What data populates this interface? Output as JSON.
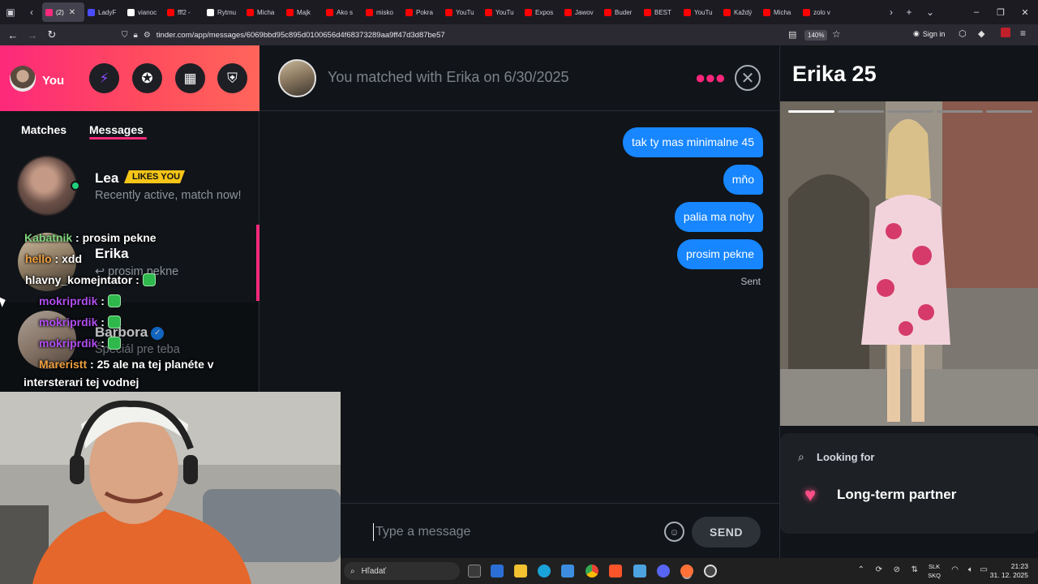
{
  "browser": {
    "tabs": [
      {
        "label": "(2)",
        "color": "#fd297b",
        "active": true
      },
      {
        "label": "LadyF",
        "color": "#4a4cff"
      },
      {
        "label": "vianoc",
        "color": "#ffffff"
      },
      {
        "label": "fff2 - ",
        "color": "#ff0000"
      },
      {
        "label": "Rytmu",
        "color": "#ffffff"
      },
      {
        "label": "Micha",
        "color": "#ff0000"
      },
      {
        "label": "Majk",
        "color": "#ff0000"
      },
      {
        "label": "Ako s",
        "color": "#ff0000"
      },
      {
        "label": "misko",
        "color": "#ff0000"
      },
      {
        "label": "Pokra",
        "color": "#ff0000"
      },
      {
        "label": "YouTu",
        "color": "#ff0000"
      },
      {
        "label": "YouTu",
        "color": "#ff0000"
      },
      {
        "label": "Expos",
        "color": "#ff0000"
      },
      {
        "label": "Jawov",
        "color": "#ff0000"
      },
      {
        "label": "Buder",
        "color": "#ff0000"
      },
      {
        "label": "BEST",
        "color": "#ff0000"
      },
      {
        "label": "YouTu",
        "color": "#ff0000"
      },
      {
        "label": "Každý",
        "color": "#ff0000"
      },
      {
        "label": "Micha",
        "color": "#ff0000"
      },
      {
        "label": "zolo v",
        "color": "#ff0000"
      }
    ],
    "url": "tinder.com/app/messages/6069bbd95c895d0100656d4f68373289aa9ff47d3d87be57",
    "zoom": "140%",
    "sign_in": "Sign in"
  },
  "left": {
    "you_label": "You",
    "tabs": {
      "matches": "Matches",
      "messages": "Messages"
    },
    "conversations": [
      {
        "name": "Lea",
        "badge": "LIKES YOU",
        "sub": "Recently active, match now!"
      },
      {
        "name": "Erika",
        "sub": "↩ prosim pekne"
      },
      {
        "name": "Barbora",
        "sub": "Špeciál pre teba"
      }
    ]
  },
  "chat_overlay": [
    {
      "user": "Kabatnik",
      "user_color": "#7fd37f",
      "text": " : prosim pekne"
    },
    {
      "user": "hello",
      "user_color": "#f0a040",
      "text": " : xdd"
    },
    {
      "user": "hlavny_komejntator",
      "user_color": "#ffffff",
      "text": " :"
    },
    {
      "user": "mokriprdik",
      "user_color": "#b04ef0",
      "text": " :"
    },
    {
      "user": "mokriprdik",
      "user_color": "#b04ef0",
      "text": " :"
    },
    {
      "user": "mokriprdik",
      "user_color": "#b04ef0",
      "text": " :"
    },
    {
      "user": "Mareristt",
      "user_color": "#f0a040",
      "text": " : 25 ale na tej planéte v"
    },
    {
      "user": "",
      "user_color": "#ffffff",
      "text": "intersterari tej vodnej"
    }
  ],
  "chat": {
    "match_text": "You matched with Erika on 6/30/2025",
    "messages": [
      "tak ty mas minimalne 45",
      "mňo",
      "palia ma nohy",
      "prosim pekne"
    ],
    "status": "Sent",
    "input_placeholder": "Type a message",
    "send_label": "SEND"
  },
  "profile": {
    "name": "Erika 25",
    "looking_for_label": "Looking for",
    "looking_for_value": "Long-term partner"
  },
  "taskbar": {
    "search_label": "Hľadať",
    "lang_top": "SLK",
    "lang_bottom": "SKQ",
    "time": "21:23",
    "date": "31. 12. 2025"
  },
  "colors": {
    "brand": "#fd297b",
    "bubble": "#1786ff"
  }
}
